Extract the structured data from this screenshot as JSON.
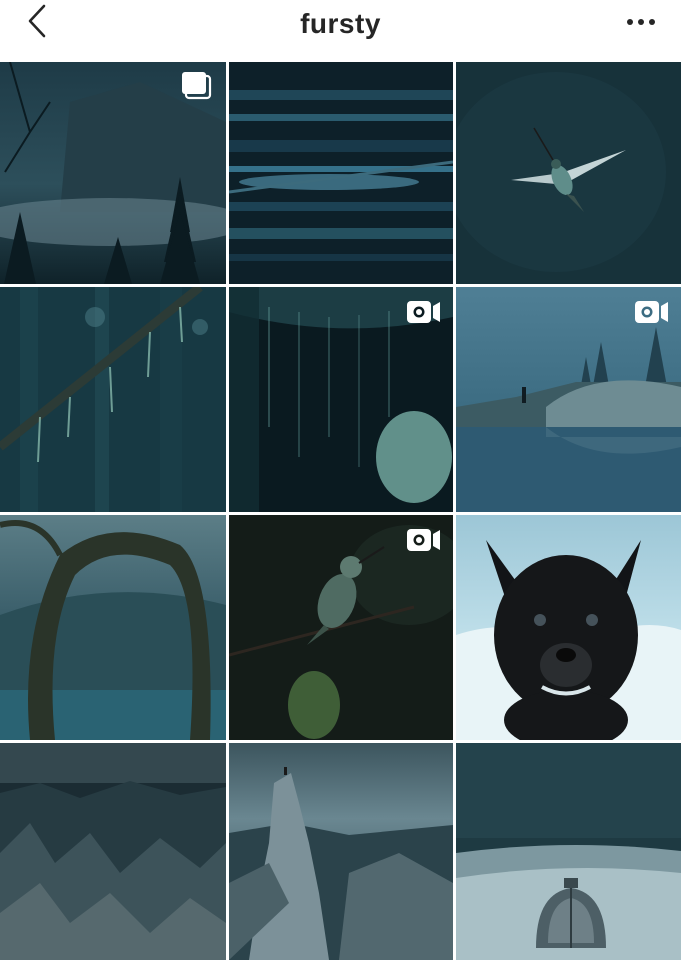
{
  "header": {
    "title": "fursty",
    "back_icon": "chevron-left-icon",
    "more_icon": "more-horizontal-icon"
  },
  "colors": {
    "title_text": "#262626",
    "tile_gap": "#ffffff",
    "palette": [
      "#0e2a36",
      "#163d4c",
      "#2f5b6a",
      "#5f8d9b",
      "#8fb8c4",
      "#d9ecf1"
    ]
  },
  "grid": {
    "columns": 3,
    "rows": 4,
    "posts": [
      {
        "id": "post-1",
        "subject": "misty-forest-mountain",
        "badge": "carousel-icon"
      },
      {
        "id": "post-2",
        "subject": "fallen-logs-stream",
        "badge": null
      },
      {
        "id": "post-3",
        "subject": "hummingbird-flight",
        "badge": null
      },
      {
        "id": "post-4",
        "subject": "mossy-branch-forest",
        "badge": null
      },
      {
        "id": "post-5",
        "subject": "hanging-vines-night",
        "badge": "video-icon"
      },
      {
        "id": "post-6",
        "subject": "hiker-lake-reflection",
        "badge": "video-icon"
      },
      {
        "id": "post-7",
        "subject": "mossy-tree-arch-lake",
        "badge": null
      },
      {
        "id": "post-8",
        "subject": "hummingbird-perched",
        "badge": "video-icon"
      },
      {
        "id": "post-9",
        "subject": "black-puppy-snow",
        "badge": null
      },
      {
        "id": "post-10",
        "subject": "rocky-canyon",
        "badge": null
      },
      {
        "id": "post-11",
        "subject": "rock-spire-canyon",
        "badge": null
      },
      {
        "id": "post-12",
        "subject": "dome-tent-snow",
        "badge": null
      }
    ]
  }
}
